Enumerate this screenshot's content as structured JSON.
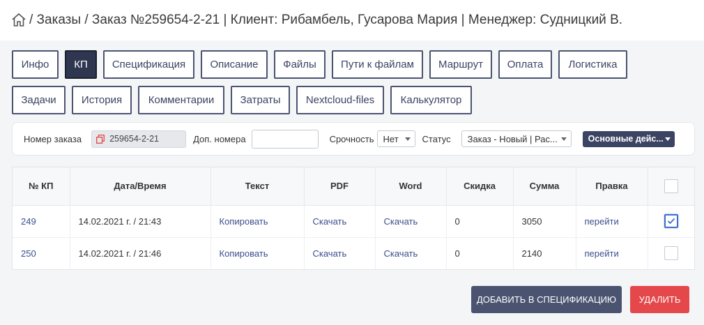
{
  "header": {
    "home_icon": "home-icon",
    "breadcrumb": [
      "/ Заказы",
      "/ Заказ №259654-2-21",
      "| Клиент: Рибамбель, Гусарова Мария",
      "| Менеджер: Судницкий В."
    ]
  },
  "tabs": {
    "row1": [
      "Инфо",
      "КП",
      "Спецификация",
      "Описание",
      "Файлы",
      "Пути к файлам",
      "Маршрут",
      "Оплата",
      "Логистика"
    ],
    "row2": [
      "Задачи",
      "История",
      "Комментарии",
      "Затраты",
      "Nextcloud-files",
      "Калькулятор"
    ],
    "active": "КП"
  },
  "filters": {
    "order_number_label": "Номер заказа",
    "order_number_value": "259654-2-21",
    "extra_numbers_label": "Доп. номера",
    "extra_numbers_value": "",
    "urgency_label": "Срочность",
    "urgency_value": "Нет",
    "status_label": "Статус",
    "status_value": "Заказ - Новый | Рас...",
    "actions_label": "Основные дейс..."
  },
  "table": {
    "headers": [
      "№ КП",
      "Дата/Время",
      "Текст",
      "PDF",
      "Word",
      "Скидка",
      "Сумма",
      "Правка"
    ],
    "rows": [
      {
        "num": "249",
        "datetime": "14.02.2021 г. / 21:43",
        "text": "Копировать",
        "pdf": "Скачать",
        "word": "Скачать",
        "discount": "0",
        "sum": "3050",
        "edit": "перейти",
        "checked": true
      },
      {
        "num": "250",
        "datetime": "14.02.2021 г. / 21:46",
        "text": "Копировать",
        "pdf": "Скачать",
        "word": "Скачать",
        "discount": "0",
        "sum": "2140",
        "edit": "перейти",
        "checked": false
      }
    ]
  },
  "buttons": {
    "add_to_spec": "ДОБАВИТЬ В СПЕЦИФИКАЦИЮ",
    "delete": "УДАЛИТЬ"
  },
  "colors": {
    "tab_border": "#4a5470",
    "tab_active_bg": "#2e3650",
    "link": "#3c4e8a",
    "delete_btn": "#e5484b",
    "add_btn": "#4a5471"
  }
}
